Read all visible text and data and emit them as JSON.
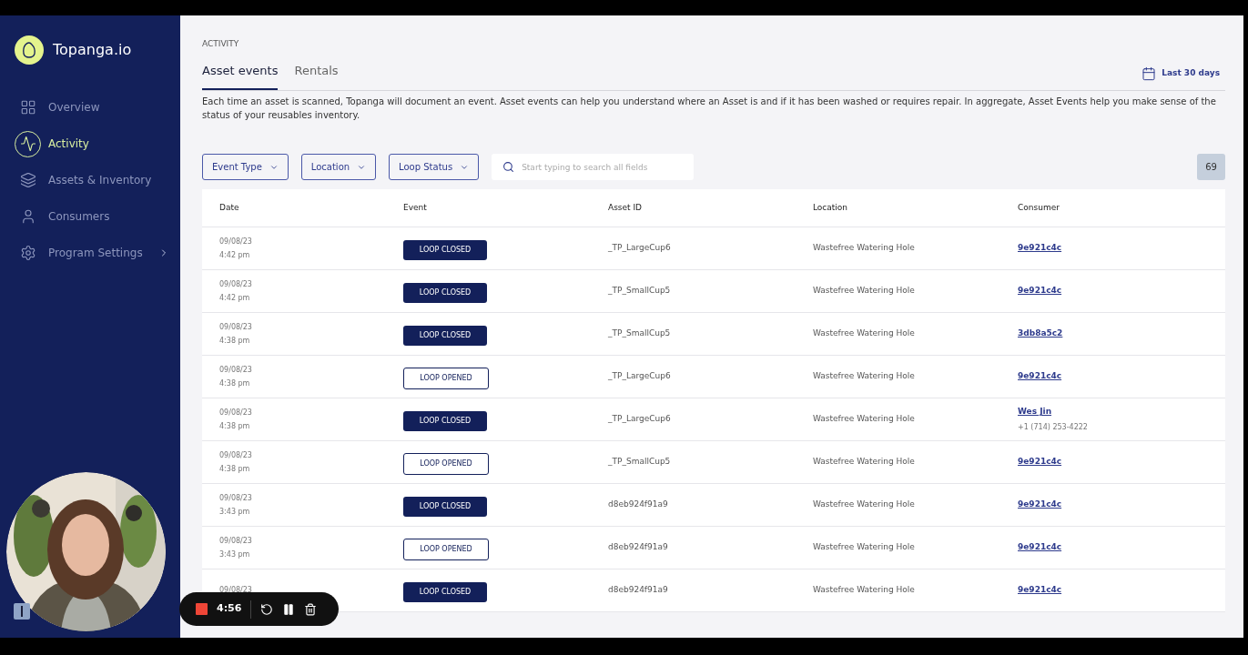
{
  "sidebar": {
    "brand": "Topanga.io",
    "items": [
      {
        "label": "Overview",
        "selected": false,
        "has_submenu": false
      },
      {
        "label": "Activity",
        "selected": true,
        "has_submenu": false
      },
      {
        "label": "Assets & Inventory",
        "selected": false,
        "has_submenu": false
      },
      {
        "label": "Consumers",
        "selected": false,
        "has_submenu": false
      },
      {
        "label": "Program Settings",
        "selected": false,
        "has_submenu": true
      }
    ]
  },
  "breadcrumb": "ACTIVITY",
  "tabs": [
    {
      "label": "Asset events",
      "selected": true
    },
    {
      "label": "Rentals",
      "selected": false
    }
  ],
  "date_range": "Last 30 days",
  "description": "Each time an asset is scanned, Topanga will document an event. Asset events can help you understand where an Asset is and if it has been washed or requires repair. In aggregate, Asset Events help you make sense of the status of your reusables inventory.",
  "filters": [
    "Event Type",
    "Location",
    "Loop Status"
  ],
  "search": {
    "placeholder": "Start typing to search all fields"
  },
  "count": "69",
  "table": {
    "columns": [
      "Date",
      "Event",
      "Asset ID",
      "Location",
      "Consumer"
    ],
    "rows": [
      {
        "date": "09/08/23",
        "time": "4:42 pm",
        "event": "LOOP CLOSED",
        "kind": "closed",
        "asset": "_TP_LargeCup6",
        "location": "Wastefree Watering Hole",
        "consumer": "9e921c4c"
      },
      {
        "date": "09/08/23",
        "time": "4:42 pm",
        "event": "LOOP CLOSED",
        "kind": "closed",
        "asset": "_TP_SmallCup5",
        "location": "Wastefree Watering Hole",
        "consumer": "9e921c4c"
      },
      {
        "date": "09/08/23",
        "time": "4:38 pm",
        "event": "LOOP CLOSED",
        "kind": "closed",
        "asset": "_TP_SmallCup5",
        "location": "Wastefree Watering Hole",
        "consumer": "3db8a5c2"
      },
      {
        "date": "09/08/23",
        "time": "4:38 pm",
        "event": "LOOP OPENED",
        "kind": "opened",
        "asset": "_TP_LargeCup6",
        "location": "Wastefree Watering Hole",
        "consumer": "9e921c4c"
      },
      {
        "date": "09/08/23",
        "time": "4:38 pm",
        "event": "LOOP CLOSED",
        "kind": "closed",
        "asset": "_TP_LargeCup6",
        "location": "Wastefree Watering Hole",
        "consumer": "Wes Jin",
        "phone": "+1 (714) 253-4222"
      },
      {
        "date": "09/08/23",
        "time": "4:38 pm",
        "event": "LOOP OPENED",
        "kind": "opened",
        "asset": "_TP_SmallCup5",
        "location": "Wastefree Watering Hole",
        "consumer": "9e921c4c"
      },
      {
        "date": "09/08/23",
        "time": "3:43 pm",
        "event": "LOOP CLOSED",
        "kind": "closed",
        "asset": "d8eb924f91a9",
        "location": "Wastefree Watering Hole",
        "consumer": "9e921c4c"
      },
      {
        "date": "09/08/23",
        "time": "3:43 pm",
        "event": "LOOP OPENED",
        "kind": "opened",
        "asset": "d8eb924f91a9",
        "location": "Wastefree Watering Hole",
        "consumer": "9e921c4c"
      },
      {
        "date": "09/08/23",
        "event": "LOOP CLOSED",
        "kind": "closed",
        "asset": "d8eb924f91a9",
        "location": "Wastefree Watering Hole",
        "consumer": "9e921c4c"
      }
    ]
  },
  "recorder": {
    "timer": "4:56"
  }
}
